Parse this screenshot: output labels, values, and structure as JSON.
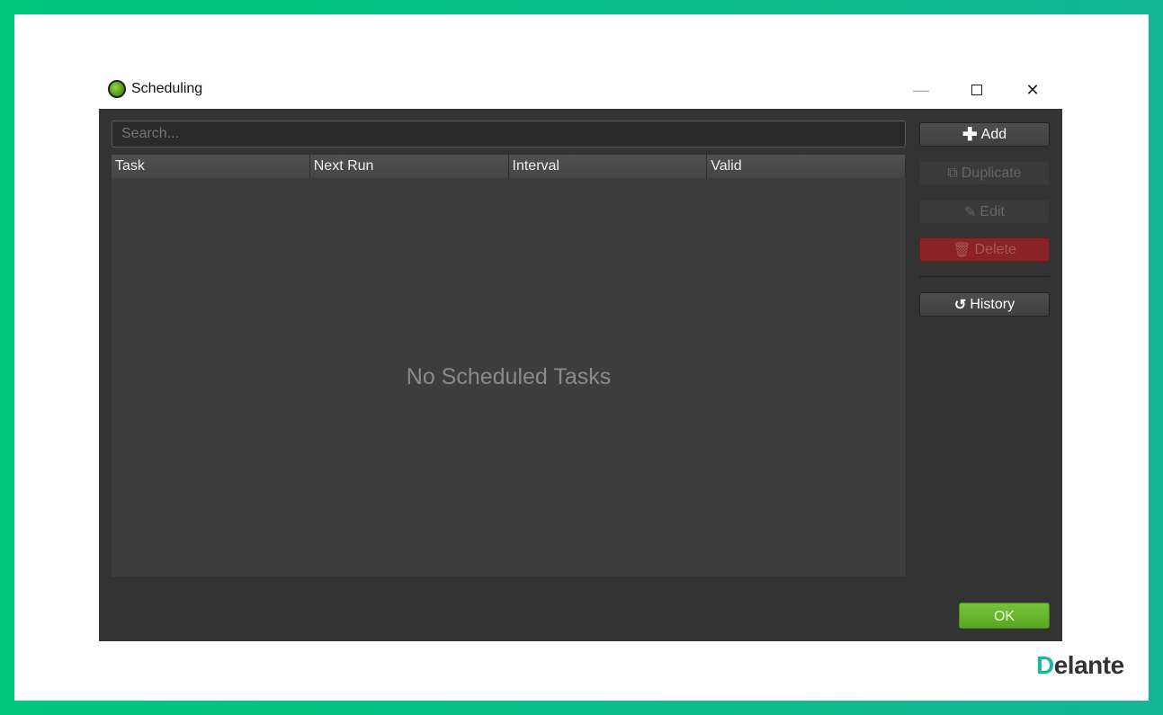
{
  "window": {
    "title": "Scheduling",
    "icon": "app-logo-icon",
    "controls": [
      "minimize-icon",
      "maximize-icon",
      "close-icon"
    ]
  },
  "search": {
    "placeholder": "Search..."
  },
  "table": {
    "columns": [
      "Task",
      "Next Run",
      "Interval",
      "Valid"
    ],
    "rows": [],
    "empty_message": "No Scheduled Tasks"
  },
  "buttons": {
    "add": "Add",
    "duplicate": "Duplicate",
    "edit": "Edit",
    "delete": "Delete",
    "history": "History",
    "ok": "OK"
  },
  "brand": {
    "first": "D",
    "rest": "elante"
  },
  "colors": {
    "frame": "#00c97c",
    "ok": "#6ab82e",
    "delete": "#8a2226",
    "body": "#333333"
  }
}
